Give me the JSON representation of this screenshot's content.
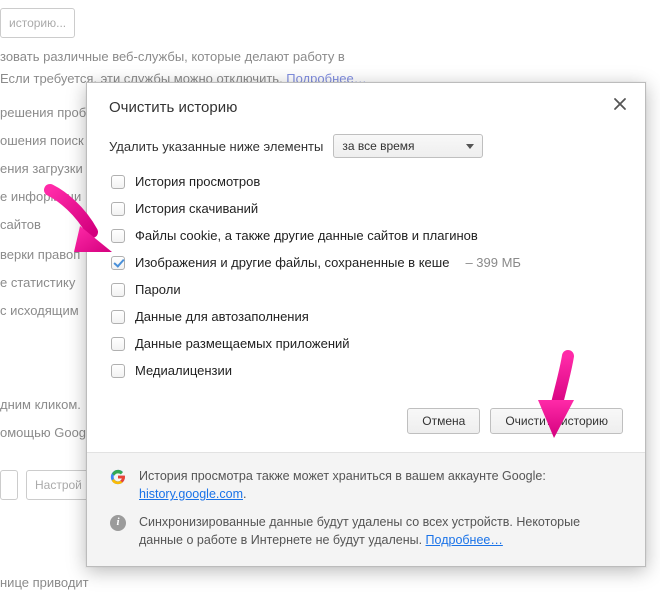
{
  "bg": {
    "history_btn": "историю...",
    "para1a": "зовать различные веб-службы, которые делают работу в",
    "para1b_prefix": "Если требуется, эти службы можно отключить. ",
    "para1b_link": "Подробнее…",
    "lines": [
      "решения проб",
      "ошения поиск",
      "ения загрузки",
      "е информаци",
      "сайтов",
      "верки правоп",
      "е статистику ",
      "с исходящим",
      "дним кликом.",
      "омощью Googl"
    ],
    "settings_btn": "Настрой",
    "footer_line": "нице приводит"
  },
  "dialog": {
    "title": "Очистить историю",
    "range_label": "Удалить указанные ниже элементы",
    "range_selected": "за все время",
    "options": [
      {
        "label": "История просмотров",
        "checked": false
      },
      {
        "label": "История скачиваний",
        "checked": false
      },
      {
        "label": "Файлы cookie, а также другие данные сайтов и плагинов",
        "checked": false
      },
      {
        "label": "Изображения и другие файлы, сохраненные в кеше",
        "checked": true,
        "hint_sep": "–",
        "hint_size": "399 МБ"
      },
      {
        "label": "Пароли",
        "checked": false
      },
      {
        "label": "Данные для автозаполнения",
        "checked": false
      },
      {
        "label": "Данные размещаемых приложений",
        "checked": false
      },
      {
        "label": "Медиалицензии",
        "checked": false
      }
    ],
    "cancel": "Отмена",
    "confirm": "Очистить историю",
    "footer": {
      "google_text": "История просмотра также может храниться в вашем аккаунте Google: ",
      "google_link": "history.google.com",
      "google_dot": ".",
      "sync_text": "Синхронизированные данные будут удалены со всех устройств. Некоторые данные о работе в Интернете не будут удалены. ",
      "sync_link": "Подробнее…"
    }
  }
}
